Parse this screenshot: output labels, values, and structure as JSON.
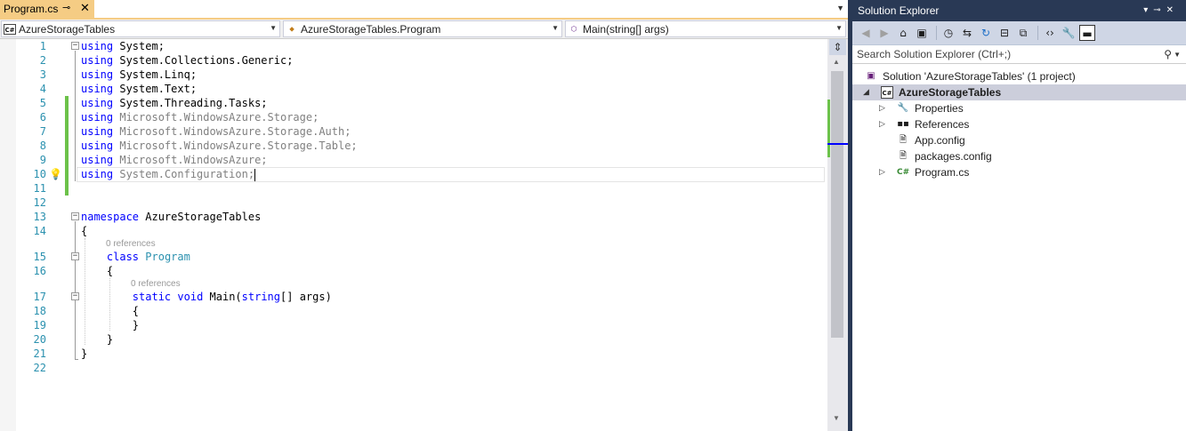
{
  "editor": {
    "tab": {
      "title": "Program.cs",
      "pin_glyph": "⊸",
      "close_glyph": "✕"
    },
    "nav": {
      "project": "AzureStorageTables",
      "class": "AzureStorageTables.Program",
      "member": "Main(string[] args)"
    },
    "lines": [
      "1",
      "2",
      "3",
      "4",
      "5",
      "6",
      "7",
      "8",
      "9",
      "10",
      "11",
      "12",
      "13",
      "14",
      "15",
      "16",
      "17",
      "18",
      "19",
      "20",
      "21",
      "22"
    ],
    "code": {
      "l1": {
        "kw": "using",
        "rest": " System;"
      },
      "l2": {
        "kw": "using",
        "rest": " System.Collections.Generic;"
      },
      "l3": {
        "kw": "using",
        "rest": " System.Linq;"
      },
      "l4": {
        "kw": "using",
        "rest": " System.Text;"
      },
      "l5": {
        "kw": "using",
        "rest": " System.Threading.Tasks;"
      },
      "l6": {
        "kw": "using",
        "rest": " Microsoft.WindowsAzure.Storage;"
      },
      "l7": {
        "kw": "using",
        "rest": " Microsoft.WindowsAzure.Storage.Auth;"
      },
      "l8": {
        "kw": "using",
        "rest": " Microsoft.WindowsAzure.Storage.Table;"
      },
      "l9": {
        "kw": "using",
        "rest": " Microsoft.WindowsAzure;"
      },
      "l10": {
        "kw": "using",
        "rest": " System.Configuration;"
      },
      "l13": {
        "kw": "namespace",
        "rest": " AzureStorageTables"
      },
      "l14": "{",
      "lens1": "0 references",
      "l15": {
        "kw": "class",
        "ty": "Program"
      },
      "l16": "{",
      "lens2": "0 references",
      "l17": {
        "kw1": "static",
        "kw2": "void",
        "name": " Main(",
        "kw3": "string",
        "rest": "[] args)"
      },
      "l18": "{",
      "l19": "}",
      "l20": "}",
      "l21": "}"
    }
  },
  "solution_explorer": {
    "title": "Solution Explorer",
    "search_placeholder": "Search Solution Explorer (Ctrl+;)",
    "tree": {
      "solution": "Solution 'AzureStorageTables' (1 project)",
      "project": "AzureStorageTables",
      "properties": "Properties",
      "references": "References",
      "app_config": "App.config",
      "packages_config": "packages.config",
      "program_cs": "Program.cs"
    }
  },
  "colors": {
    "chrome": "#293955",
    "active_tab": "#f5cc84",
    "keyword": "#0000ff",
    "type": "#2b91af",
    "line_number": "#2b91af",
    "change_bar": "#6cc24a"
  }
}
